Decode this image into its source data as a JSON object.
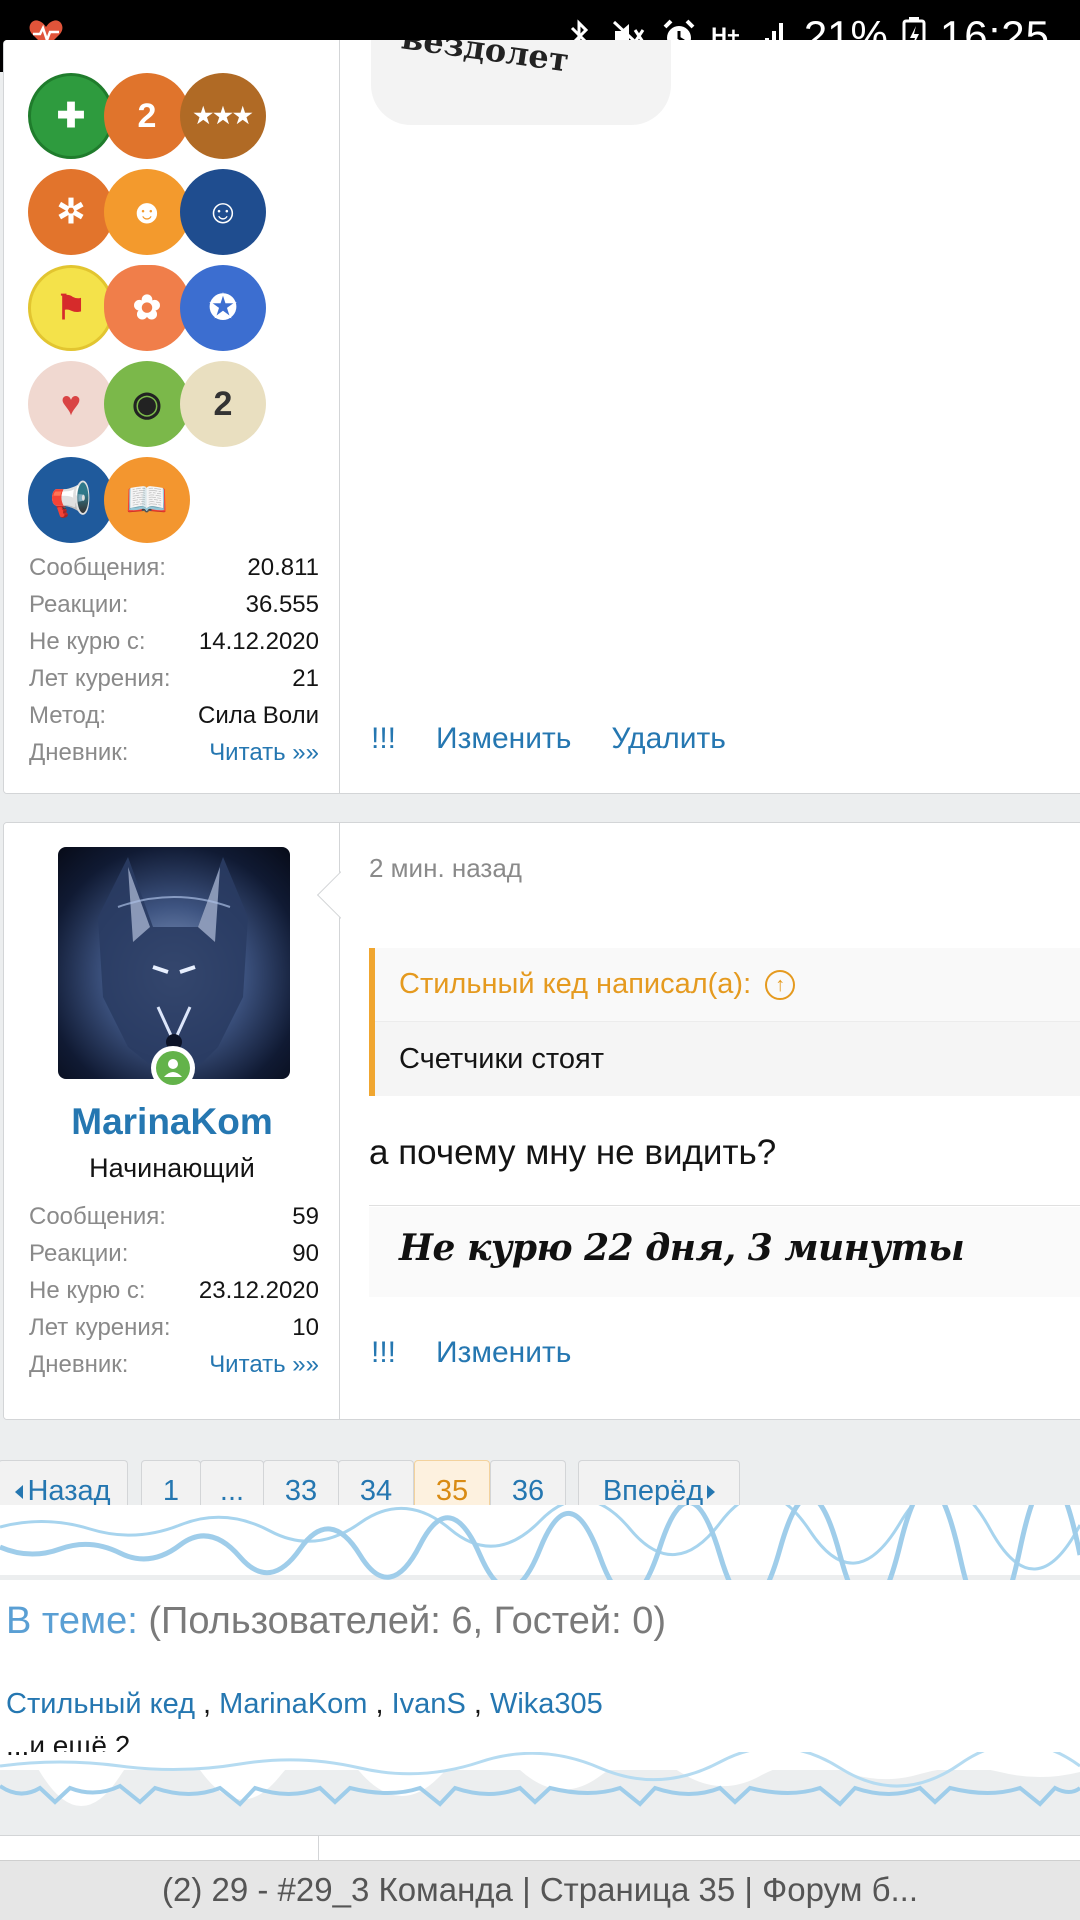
{
  "status_bar": {
    "app_icon": "heart-pulse-icon",
    "battery": "21%",
    "time": "16:25",
    "network": "H+"
  },
  "post1": {
    "badges": [
      "badge-first-aid",
      "badge-wheel-2",
      "badge-stars",
      "badge-wheel",
      "badge-people-orange",
      "badge-people-blue",
      "badge-medal",
      "badge-easter-egg",
      "badge-fitness",
      "badge-hands-heart",
      "badge-camera",
      "badge-flower-2",
      "badge-megaphone",
      "badge-book"
    ],
    "stats": [
      {
        "label": "Сообщения:",
        "value": "20.811"
      },
      {
        "label": "Реакции:",
        "value": "36.555"
      },
      {
        "label": "Не курю с:",
        "value": "14.12.2020"
      },
      {
        "label": "Лет курения:",
        "value": "21"
      },
      {
        "label": "Метод:",
        "value": "Сила Воли"
      }
    ],
    "diary_label": "Дневник:",
    "diary_link": "Читать »»",
    "image_text": "вездолет",
    "actions": {
      "report": "!!!",
      "edit": "Изменить",
      "delete": "Удалить"
    }
  },
  "post2": {
    "username": "MarinaKom",
    "user_title": "Начинающий",
    "stats": [
      {
        "label": "Сообщения:",
        "value": "59"
      },
      {
        "label": "Реакции:",
        "value": "90"
      },
      {
        "label": "Не курю с:",
        "value": "23.12.2020"
      },
      {
        "label": "Лет курения:",
        "value": "10"
      }
    ],
    "diary_label": "Дневник:",
    "diary_link": "Читать »»",
    "time": "2 мин. назад",
    "quote_author": "Стильный кед написал(а):",
    "quote_text": "Счетчики стоят",
    "message": "а почему мну не видить?",
    "signature": "Не курю 22 дня, 3 минуты",
    "actions": {
      "report": "!!!",
      "edit": "Изменить"
    }
  },
  "pagination": {
    "prev": "Назад",
    "pages": [
      "1",
      "...",
      "33",
      "34",
      "35",
      "36"
    ],
    "current": "35",
    "next": "Вперёд"
  },
  "online": {
    "label": "В теме:",
    "counts": "(Пользователей: 6, Гостей: 0)",
    "users": [
      "Стильный кед",
      "MarinaKom",
      "IvanS",
      "Wika305"
    ],
    "more": "...и ещё 2."
  },
  "browser": {
    "title": "(2) 29 - #29_3 Команда | Страница 35 | Форум б..."
  },
  "colors": {
    "link": "#2577b1",
    "accent_orange": "#f0a630",
    "online_green": "#63b34a"
  }
}
